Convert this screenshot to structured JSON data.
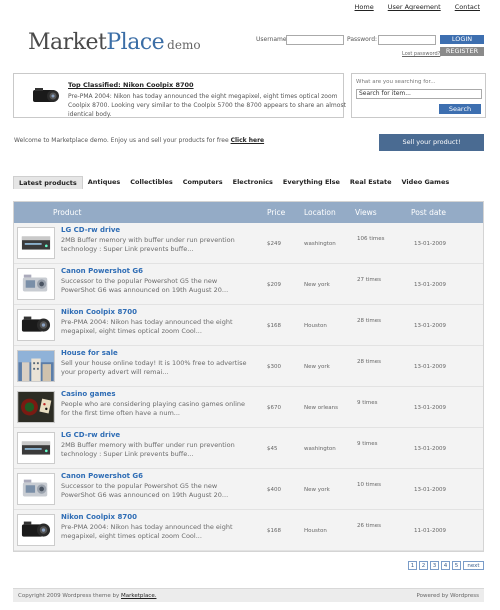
{
  "top_links": [
    "Home",
    "User Agreement",
    "Contact"
  ],
  "logo": {
    "part1": "Market",
    "part2": "Place",
    "part3": "demo"
  },
  "login": {
    "username_label": "Username:",
    "password_label": "Password:",
    "login_button": "LOGIN",
    "register_button": "REGISTER",
    "lost_password": "Lost password?"
  },
  "featured": {
    "title": "Top Classified: Nikon Coolpix 8700",
    "desc": "Pre-PMA 2004: Nikon has today announced the eight megapixel, eight times optical zoom Coolpix 8700. Looking very similar to the Coolpix 5700 the 8700 appears to share an almost identical body."
  },
  "search": {
    "question": "What are you searching for...",
    "value": "Search for item...",
    "button": "Search"
  },
  "welcome": {
    "text": "Welcome to Marketplace demo. Enjoy us and sell your products for free ",
    "link": "Click here"
  },
  "sell_button": "Sell your product!",
  "categories": [
    "Latest products",
    "Antiques",
    "Collectibles",
    "Computers",
    "Electronics",
    "Everything Else",
    "Real Estate",
    "Video Games"
  ],
  "table": {
    "headers": {
      "product": "Product",
      "price": "Price",
      "location": "Location",
      "views": "Views",
      "date": "Post date"
    },
    "rows": [
      {
        "title": "LG CD-rw drive",
        "desc": "2MB Buffer memory with buffer under run prevention technology : Super Link prevents buffe...",
        "price": "$249",
        "location": "washington",
        "views": "106 times",
        "date": "13-01-2009",
        "icon": "cd-drive-icon"
      },
      {
        "title": "Canon Powershot G6",
        "desc": "Successor to the popular Powershot G5 the new PowerShot G6 was announced on 19th August 20...",
        "price": "$209",
        "location": "New york",
        "views": "27 times",
        "date": "13-01-2009",
        "icon": "camera-silver-icon"
      },
      {
        "title": "Nikon Coolpix 8700",
        "desc": "Pre-PMA 2004: Nikon has today announced the eight megapixel, eight times optical zoom Cool...",
        "price": "$168",
        "location": "Houston",
        "views": "28 times",
        "date": "13-01-2009",
        "icon": "camera-black-icon"
      },
      {
        "title": "House for sale",
        "desc": "Sell your house online today! It is 100% free to advertise your property advert will remai...",
        "price": "$300",
        "location": "New york",
        "views": "28 times",
        "date": "13-01-2009",
        "icon": "house-icon"
      },
      {
        "title": "Casino games",
        "desc": "People who are considering playing casino games online for the first time often have a num...",
        "price": "$670",
        "location": "New orleans",
        "views": "9 times",
        "date": "13-01-2009",
        "icon": "casino-icon"
      },
      {
        "title": "LG CD-rw drive",
        "desc": "2MB Buffer memory with buffer under run prevention technology : Super Link prevents buffe...",
        "price": "$45",
        "location": "washington",
        "views": "9 times",
        "date": "13-01-2009",
        "icon": "cd-drive-icon"
      },
      {
        "title": "Canon Powershot G6",
        "desc": "Successor to the popular Powershot G5 the new PowerShot G6 was announced on 19th August 20...",
        "price": "$400",
        "location": "New york",
        "views": "10 times",
        "date": "13-01-2009",
        "icon": "camera-silver-icon"
      },
      {
        "title": "Nikon Coolpix 8700",
        "desc": "Pre-PMA 2004: Nikon has today announced the eight megapixel, eight times optical zoom Cool...",
        "price": "$168",
        "location": "Houston",
        "views": "26 times",
        "date": "11-01-2009",
        "icon": "camera-black-icon"
      }
    ]
  },
  "pagination": [
    "1",
    "2",
    "3",
    "4",
    "5",
    "next"
  ],
  "footer": {
    "copyright": "Copyright 2009 Wordpress theme by ",
    "link": "Marketplace.",
    "powered": "Powered by Wordpress"
  },
  "colors": {
    "header": "#94abc6",
    "accent": "#2f6db5",
    "button": "#3d6fb0",
    "sell": "#4a6b92"
  }
}
